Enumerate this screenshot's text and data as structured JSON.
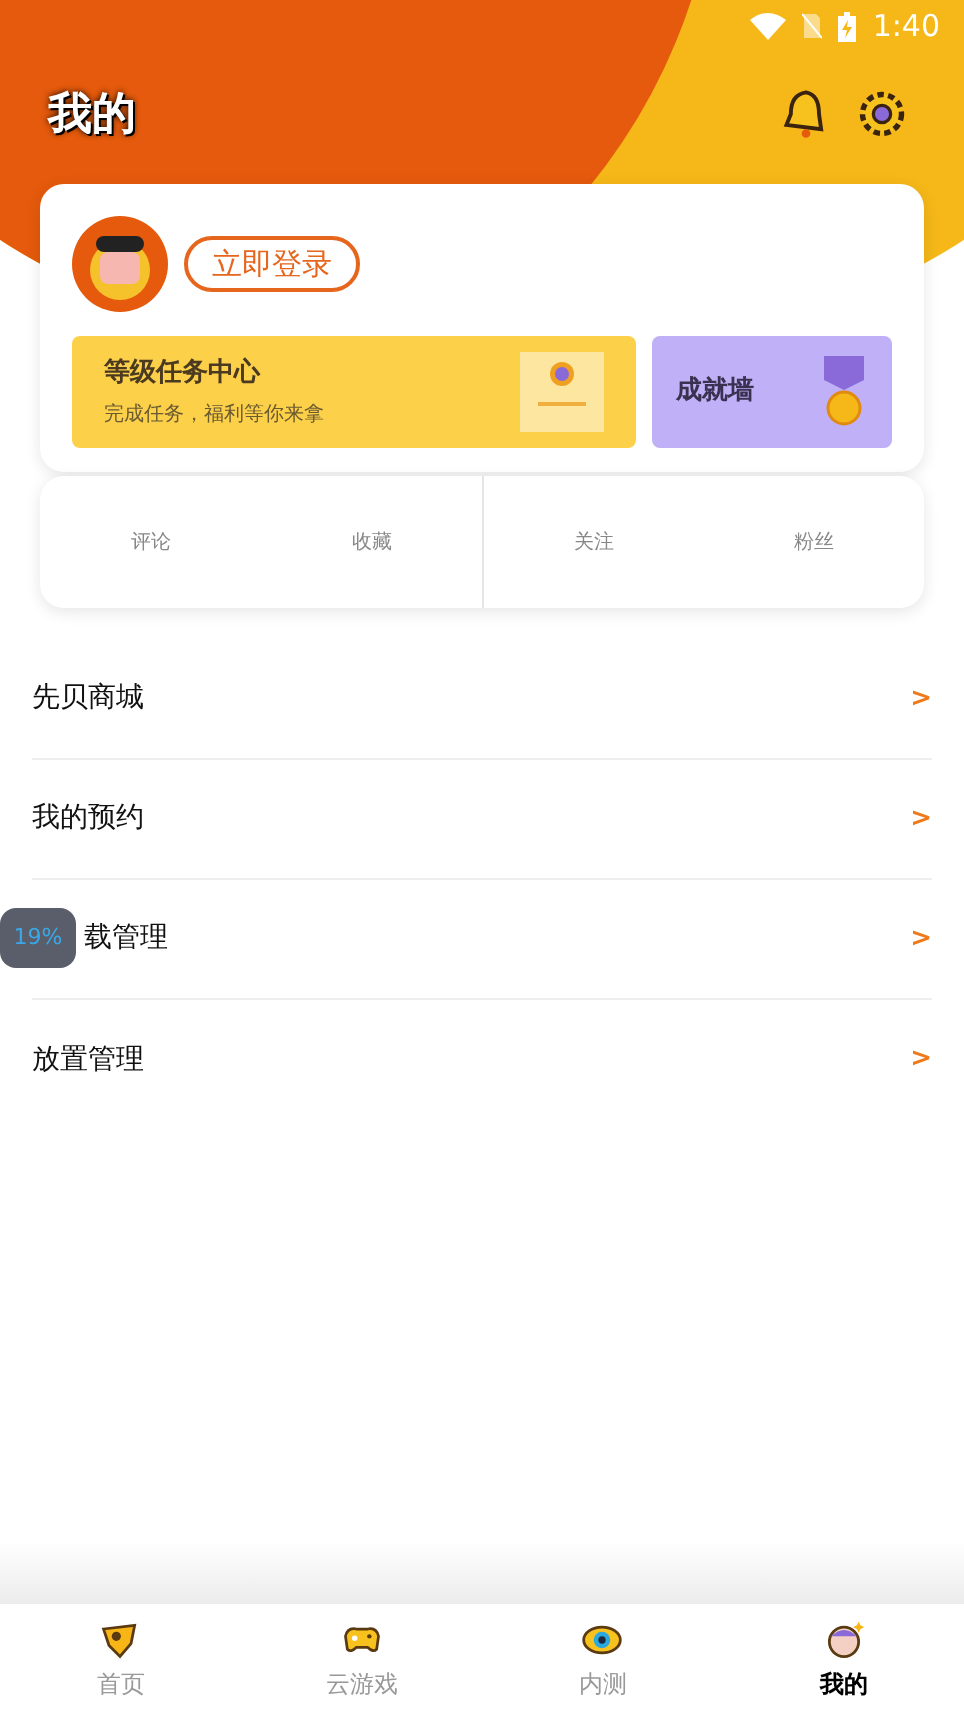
{
  "status_bar": {
    "time": "1:40"
  },
  "header": {
    "title": "我的"
  },
  "profile": {
    "login_button": "立即登录"
  },
  "level_card": {
    "title": "等级任务中心",
    "subtitle": "完成任务，福利等你来拿"
  },
  "achievement_card": {
    "title": "成就墙"
  },
  "stats": [
    {
      "label": "评论"
    },
    {
      "label": "收藏"
    },
    {
      "label": "关注"
    },
    {
      "label": "粉丝"
    }
  ],
  "menu": [
    {
      "label": "先贝商城",
      "arrow": ">"
    },
    {
      "label": "我的预约",
      "arrow": ">"
    },
    {
      "label": "载管理",
      "arrow": ">"
    },
    {
      "label": "放置管理",
      "arrow": ">"
    }
  ],
  "floating_badge": {
    "text": "19%"
  },
  "bottom_nav": [
    {
      "label": "首页",
      "selected": false
    },
    {
      "label": "云游戏",
      "selected": false
    },
    {
      "label": "内测",
      "selected": false
    },
    {
      "label": "我的",
      "selected": true
    }
  ]
}
